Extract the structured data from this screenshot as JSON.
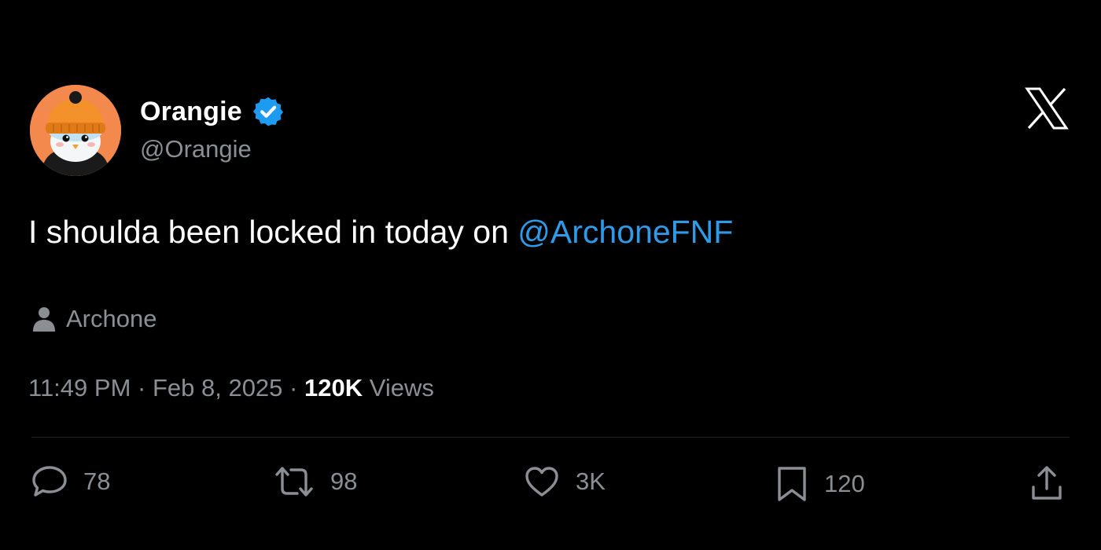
{
  "author": {
    "display_name": "Orangie",
    "handle": "@Orangie",
    "verified": true,
    "avatar_icon": "penguin-avatar"
  },
  "platform_logo": "x-logo",
  "tweet": {
    "text": "I shoulda been locked in today on ",
    "mention": "@ArchoneFNF"
  },
  "community": {
    "icon": "person-icon",
    "label": "Archone"
  },
  "meta": {
    "time": "11:49 PM",
    "separator1": " · ",
    "date": "Feb 8, 2025",
    "separator2": " · ",
    "views_count": "120K",
    "views_label": " Views"
  },
  "actions": {
    "replies": "78",
    "retweets": "98",
    "likes": "3K",
    "bookmarks": "120"
  },
  "colors": {
    "background": "#000000",
    "text": "#ffffff",
    "muted": "#8b8f94",
    "mention": "#2f9be8",
    "verified": "#1d9bf0",
    "avatar_bg": "#f4894e"
  }
}
